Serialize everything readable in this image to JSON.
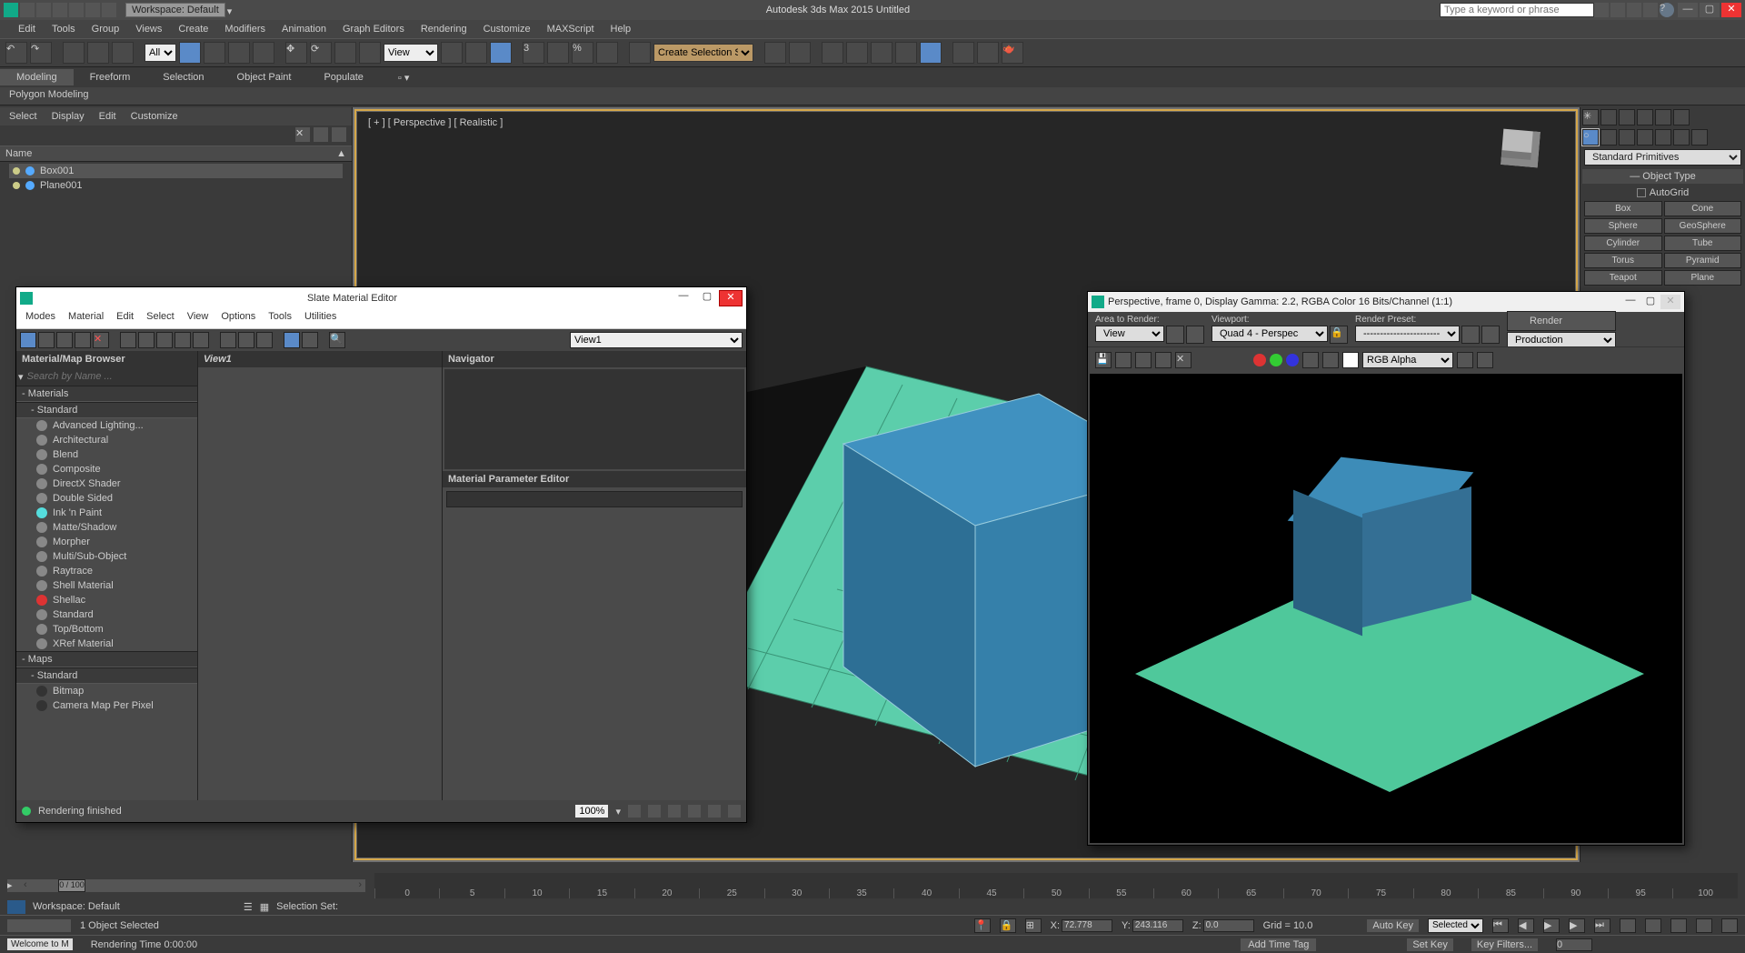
{
  "titlebar": {
    "workspace_label": "Workspace: Default",
    "app_title": "Autodesk 3ds Max  2015     Untitled",
    "search_placeholder": "Type a keyword or phrase"
  },
  "menubar": [
    "Edit",
    "Tools",
    "Group",
    "Views",
    "Create",
    "Modifiers",
    "Animation",
    "Graph Editors",
    "Rendering",
    "Customize",
    "MAXScript",
    "Help"
  ],
  "toolbar": {
    "filter_dd": "All",
    "refsys_dd": "View",
    "named_sel": "Create Selection Se"
  },
  "ribbon": {
    "tabs": [
      "Modeling",
      "Freeform",
      "Selection",
      "Object Paint",
      "Populate"
    ],
    "sub": "Polygon Modeling"
  },
  "scene_explorer": {
    "menus": [
      "Select",
      "Display",
      "Edit",
      "Customize"
    ],
    "header": "Name",
    "items": [
      {
        "name": "Box001",
        "selected": true
      },
      {
        "name": "Plane001",
        "selected": false
      }
    ]
  },
  "viewport": {
    "label": "[ + ] [ Perspective ] [ Realistic ]"
  },
  "command_panel": {
    "dropdown": "Standard Primitives",
    "section": "Object Type",
    "autogrid": "AutoGrid",
    "buttons": [
      [
        "Box",
        "Cone"
      ],
      [
        "Sphere",
        "GeoSphere"
      ],
      [
        "Cylinder",
        "Tube"
      ],
      [
        "Torus",
        "Pyramid"
      ],
      [
        "Teapot",
        "Plane"
      ]
    ]
  },
  "sme": {
    "title": "Slate Material Editor",
    "menus": [
      "Modes",
      "Material",
      "Edit",
      "Select",
      "View",
      "Options",
      "Tools",
      "Utilities"
    ],
    "view_dd": "View1",
    "browser_title": "Material/Map Browser",
    "search_placeholder": "Search by Name ...",
    "cats": {
      "materials": "Materials",
      "standard": "Standard",
      "maps": "Maps",
      "maps_std": "Standard"
    },
    "mat_list": [
      "Advanced Lighting...",
      "Architectural",
      "Blend",
      "Composite",
      "DirectX Shader",
      "Double Sided",
      "Ink 'n Paint",
      "Matte/Shadow",
      "Morpher",
      "Multi/Sub-Object",
      "Raytrace",
      "Shell Material",
      "Shellac",
      "Standard",
      "Top/Bottom",
      "XRef Material"
    ],
    "map_list": [
      "Bitmap",
      "Camera Map Per Pixel"
    ],
    "view_hdr": "View1",
    "nav_hdr": "Navigator",
    "ped_hdr": "Material Parameter Editor",
    "status": "Rendering finished",
    "zoom": "100%"
  },
  "render": {
    "title": "Perspective, frame 0, Display Gamma: 2.2, RGBA Color 16 Bits/Channel (1:1)",
    "labels": {
      "area": "Area to Render:",
      "vp": "Viewport:",
      "preset": "Render Preset:"
    },
    "area_dd": "View",
    "vp_dd": "Quad 4 - Perspec",
    "preset_dd": "-----------------------",
    "prod_dd": "Production",
    "render_btn": "Render",
    "alpha_dd": "RGB Alpha"
  },
  "timeline": {
    "frame_label": "0 / 100",
    "ticks": [
      0,
      5,
      10,
      15,
      20,
      25,
      30,
      35,
      40,
      45,
      50,
      55,
      60,
      65,
      70,
      75,
      80,
      85,
      90,
      95,
      100
    ],
    "ws_label": "Workspace: Default",
    "selset_label": "Selection Set:"
  },
  "status": {
    "obj": "1 Object Selected",
    "x": "72.778",
    "y": "243.116",
    "z": "0.0",
    "grid": "Grid = 10.0",
    "autokey": "Auto Key",
    "selected": "Selected",
    "setkey": "Set Key",
    "keyfilters": "Key Filters...",
    "addtag": "Add Time Tag",
    "welcome": "Welcome to M",
    "rtime": "Rendering Time  0:00:00"
  }
}
